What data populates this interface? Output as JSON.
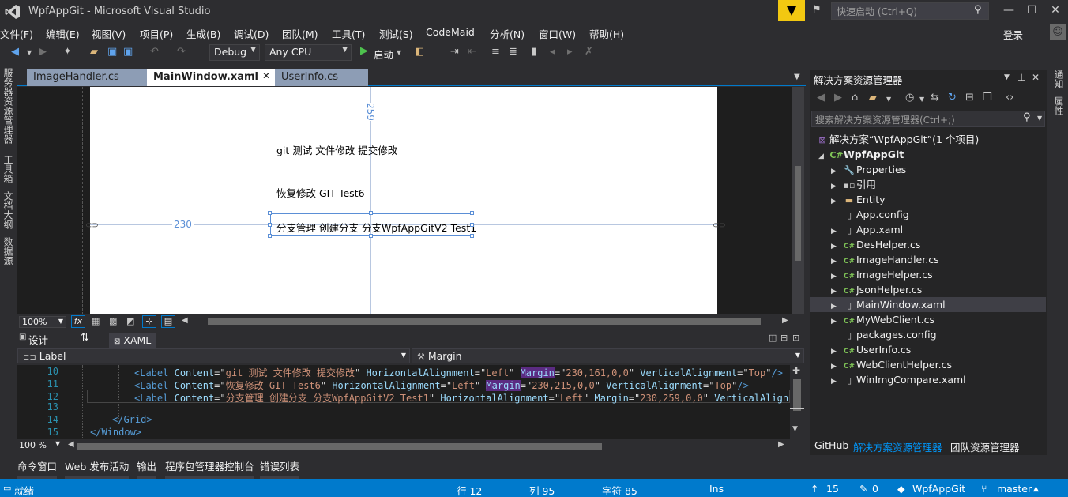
{
  "window": {
    "title": "WpfAppGit - Microsoft Visual Studio",
    "quick_launch_placeholder": "快速启动 (Ctrl+Q)",
    "login": "登录"
  },
  "menu": [
    "文件(F)",
    "编辑(E)",
    "视图(V)",
    "项目(P)",
    "生成(B)",
    "调试(D)",
    "团队(M)",
    "工具(T)",
    "测试(S)",
    "CodeMaid",
    "分析(N)",
    "窗口(W)",
    "帮助(H)"
  ],
  "toolbar": {
    "config": "Debug",
    "platform": "Any CPU",
    "start": "启动"
  },
  "left_tabs": [
    "服务器资源管理器",
    "工具箱",
    "文档大纲",
    "数据源"
  ],
  "right_tabs": [
    "通知",
    "属性"
  ],
  "doc_tabs": [
    {
      "label": "ImageHandler.cs"
    },
    {
      "label": "MainWindow.xaml"
    },
    {
      "label": "UserInfo.cs"
    }
  ],
  "design": {
    "labels": [
      "git 测试 文件修改 提交修改",
      "恢复修改 GIT Test6",
      "分支管理 创建分支 分支WpfAppGitV2 Test1"
    ],
    "dim_left": "230",
    "dim_top": "259",
    "zoom": "100%"
  },
  "split": {
    "design_tab": "设计",
    "swap": "⇅",
    "xaml_tab": "XAML"
  },
  "selectors": {
    "element": "Label",
    "property": "Margin"
  },
  "code": {
    "zoom": "100 %",
    "lines": [
      {
        "n": "10",
        "label_content": "git 测试 文件修改 提交修改",
        "margin": "230,161,0,0",
        "hl": true
      },
      {
        "n": "11",
        "label_content": "恢复修改 GIT Test6",
        "margin": "230,215,0,0",
        "hl": true
      },
      {
        "n": "12",
        "label_content": "分支管理 创建分支 分支WpfAppGitV2 Test1",
        "margin": "230,259,0,0",
        "hl": false
      },
      {
        "n": "13"
      },
      {
        "n": "14",
        "text": "</Grid>"
      },
      {
        "n": "15",
        "text": "</Window>"
      }
    ]
  },
  "tool_tabs": [
    "命令窗口",
    "Web 发布活动",
    "输出",
    "程序包管理器控制台",
    "错误列表"
  ],
  "solution_explorer": {
    "title": "解决方案资源管理器",
    "search_placeholder": "搜索解决方案资源管理器(Ctrl+;)",
    "solution": "解决方案“WpfAppGit”(1 个项目)",
    "project": "WpfAppGit",
    "items": [
      {
        "label": "Properties",
        "icon": "wrench-icon",
        "expandable": true
      },
      {
        "label": "引用",
        "icon": "references-icon",
        "expandable": true
      },
      {
        "label": "Entity",
        "icon": "folder-icon",
        "expandable": true
      },
      {
        "label": "App.config",
        "icon": "config-file-icon",
        "expandable": false
      },
      {
        "label": "App.xaml",
        "icon": "xaml-file-icon",
        "expandable": true
      },
      {
        "label": "DesHelper.cs",
        "icon": "csharp-file-icon",
        "expandable": true
      },
      {
        "label": "ImageHandler.cs",
        "icon": "csharp-file-icon",
        "expandable": true
      },
      {
        "label": "ImageHelper.cs",
        "icon": "csharp-file-icon",
        "expandable": true
      },
      {
        "label": "JsonHelper.cs",
        "icon": "csharp-file-icon",
        "expandable": true
      },
      {
        "label": "MainWindow.xaml",
        "icon": "xaml-file-icon",
        "expandable": true,
        "selected": true
      },
      {
        "label": "MyWebClient.cs",
        "icon": "csharp-file-icon",
        "expandable": true
      },
      {
        "label": "packages.config",
        "icon": "config-file-icon",
        "expandable": false
      },
      {
        "label": "UserInfo.cs",
        "icon": "csharp-file-icon",
        "expandable": true
      },
      {
        "label": "WebClientHelper.cs",
        "icon": "csharp-file-icon",
        "expandable": true
      },
      {
        "label": "WinImgCompare.xaml",
        "icon": "xaml-file-icon",
        "expandable": true
      }
    ],
    "tabs": [
      "GitHub",
      "解决方案资源管理器",
      "团队资源管理器"
    ]
  },
  "status": {
    "ready": "就绪",
    "row": "行 12",
    "col": "列 95",
    "char": "字符 85",
    "ins": "Ins",
    "up": "15",
    "changes": "0",
    "repo": "WpfAppGit",
    "branch": "master"
  },
  "colors": {
    "accent": "#007acc",
    "background": "#2d2d30",
    "editor": "#1e1e1e"
  }
}
